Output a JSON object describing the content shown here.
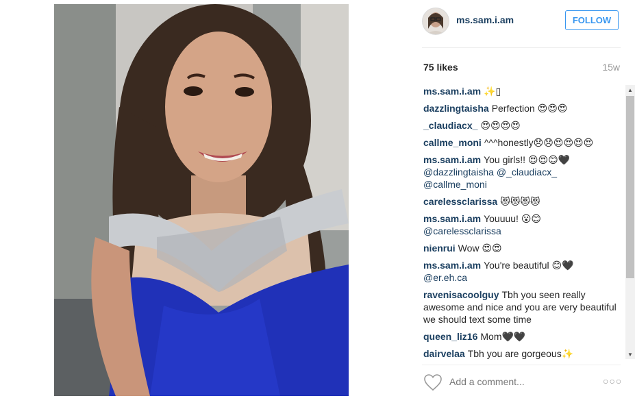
{
  "post": {
    "username": "ms.sam.i.am",
    "follow_label": "FOLLOW",
    "likes": "75 likes",
    "age": "15w",
    "comment_placeholder": "Add a comment...",
    "more_label": "○○○"
  },
  "comments": [
    {
      "user": "ms.sam.i.am",
      "text": "✨▯",
      "mentions": ""
    },
    {
      "user": "dazzlingtaisha",
      "text": "Perfection 😍😍😍",
      "mentions": ""
    },
    {
      "user": "_claudiacx_",
      "text": "😍😍😍😍",
      "mentions": ""
    },
    {
      "user": "callme_moni",
      "text": "^^^honestly😞😞😍😍😍😍",
      "mentions": ""
    },
    {
      "user": "ms.sam.i.am",
      "text": "You girls!! 😍😍😊🖤",
      "mentions": "@dazzlingtaisha @_claudiacx_ @callme_moni"
    },
    {
      "user": "carelessclarissa",
      "text": "😻😻😻😻",
      "mentions": ""
    },
    {
      "user": "ms.sam.i.am",
      "text": "Youuuu! 😮😊",
      "mentions": "@carelessclarissa"
    },
    {
      "user": "nienrui",
      "text": "Wow 😍😍",
      "mentions": ""
    },
    {
      "user": "ms.sam.i.am",
      "text": "You're beautiful 😊🖤",
      "mentions": "@er.eh.ca"
    },
    {
      "user": "ravenisacoolguy",
      "text": "Tbh you seen really awesome and nice and you are very beautiful we should text some time",
      "mentions": ""
    },
    {
      "user": "queen_liz16",
      "text": "Mom🖤🖤",
      "mentions": ""
    },
    {
      "user": "dairvelaa",
      "text": "Tbh you are gorgeous✨",
      "mentions": ""
    }
  ],
  "colors": {
    "accent": "#3897f0",
    "username": "#1b3f60",
    "muted": "#999999"
  },
  "icons": {
    "heart": "heart-icon",
    "more": "more-options-icon"
  }
}
